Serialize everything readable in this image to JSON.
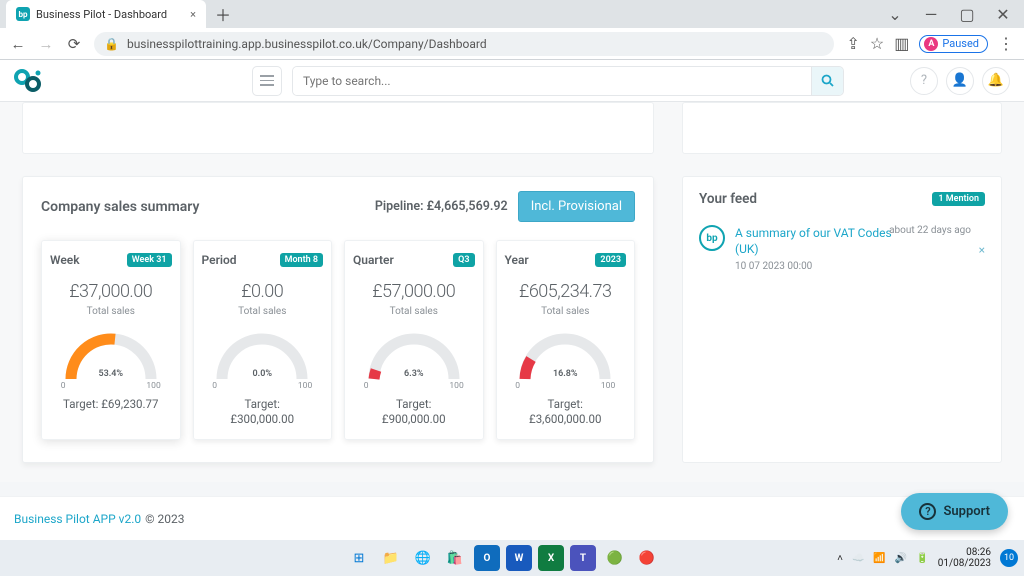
{
  "browser": {
    "tab_title": "Business Pilot - Dashboard",
    "url": "businesspilottraining.app.businesspilot.co.uk/Company/Dashboard",
    "profile_state": "Paused",
    "profile_initial": "A"
  },
  "app_header": {
    "search_placeholder": "Type to search..."
  },
  "summary": {
    "title": "Company sales summary",
    "pipeline_label": "Pipeline:",
    "pipeline_value": "£4,665,569.92",
    "provisional_button": "Incl. Provisional",
    "cards": {
      "week": {
        "name": "Week",
        "badge": "Week 31",
        "value": "£37,000.00",
        "sub": "Total sales",
        "pct": "53.4%",
        "target": "Target: £69,230.77"
      },
      "period": {
        "name": "Period",
        "badge": "Month 8",
        "value": "£0.00",
        "sub": "Total sales",
        "pct": "0.0%",
        "target_l1": "Target:",
        "target_l2": "£300,000.00"
      },
      "quarter": {
        "name": "Quarter",
        "badge": "Q3",
        "value": "£57,000.00",
        "sub": "Total sales",
        "pct": "6.3%",
        "target_l1": "Target:",
        "target_l2": "£900,000.00"
      },
      "year": {
        "name": "Year",
        "badge": "2023",
        "value": "£605,234.73",
        "sub": "Total sales",
        "pct": "16.8%",
        "target_l1": "Target:",
        "target_l2": "£3,600,000.00"
      }
    },
    "gauge": {
      "min": "0",
      "max": "100"
    }
  },
  "feed": {
    "title": "Your feed",
    "mention_badge": "1 Mention",
    "item": {
      "link": "A summary of our VAT Codes (UK)",
      "date": "10 07 2023 00:00",
      "when": "about 22 days ago"
    }
  },
  "footer": {
    "app_link": "Business Pilot APP v2.0",
    "copyright": "© 2023",
    "support": "Support"
  },
  "taskbar": {
    "time": "08:26",
    "date": "01/08/2023",
    "notif_count": "10"
  },
  "chart_data": [
    {
      "type": "gauge",
      "label": "Week",
      "value_pct": 53.4,
      "min": 0,
      "max": 100,
      "total_sales": 37000.0,
      "target": 69230.77,
      "color": "#ff8c1a"
    },
    {
      "type": "gauge",
      "label": "Period",
      "value_pct": 0.0,
      "min": 0,
      "max": 100,
      "total_sales": 0.0,
      "target": 300000.0,
      "color": "#e63946"
    },
    {
      "type": "gauge",
      "label": "Quarter",
      "value_pct": 6.3,
      "min": 0,
      "max": 100,
      "total_sales": 57000.0,
      "target": 900000.0,
      "color": "#e63946"
    },
    {
      "type": "gauge",
      "label": "Year",
      "value_pct": 16.8,
      "min": 0,
      "max": 100,
      "total_sales": 605234.73,
      "target": 3600000.0,
      "color": "#e63946"
    }
  ]
}
